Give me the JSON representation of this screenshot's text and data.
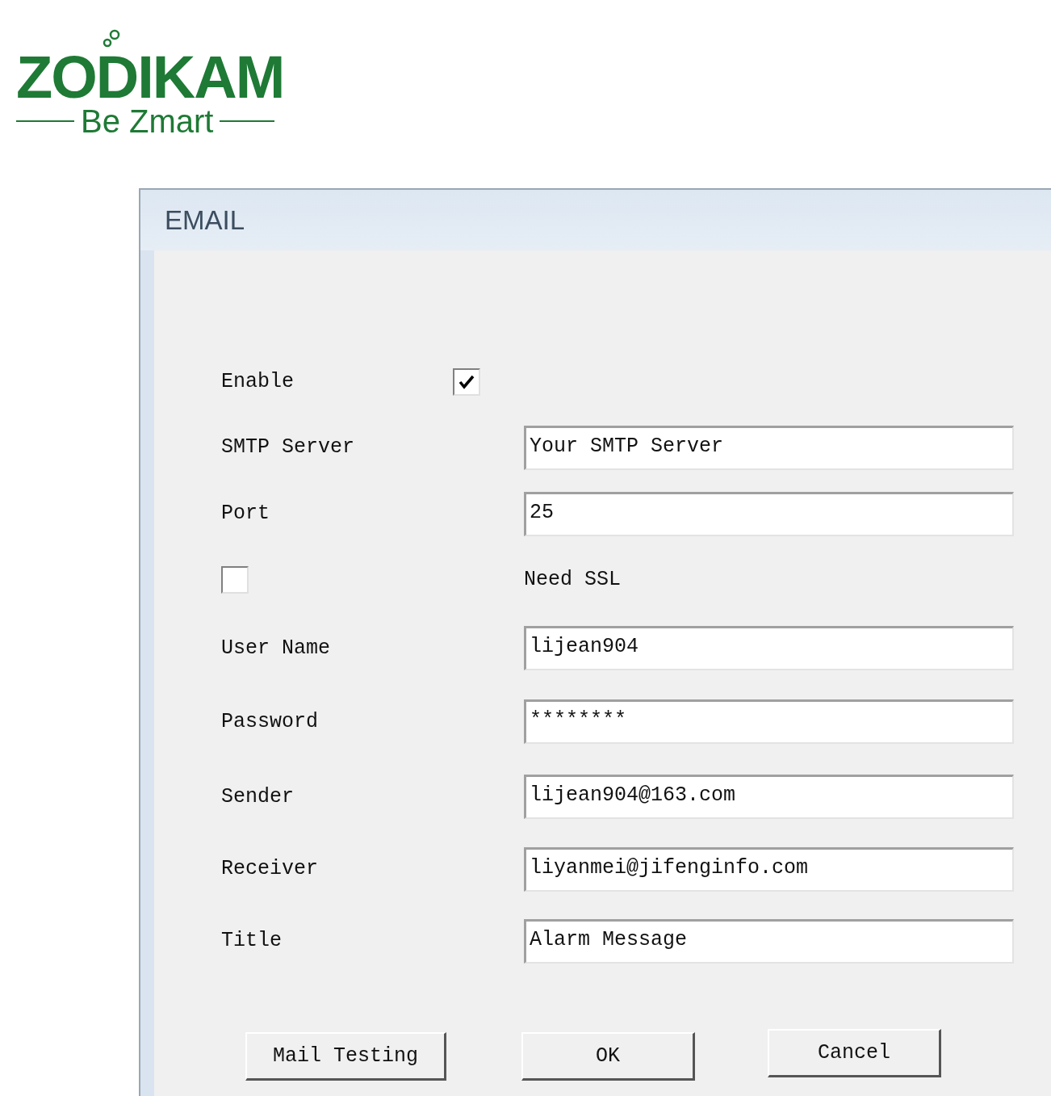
{
  "logo": {
    "name": "ZODIKAM",
    "tagline": "Be Zmart"
  },
  "window": {
    "title": "EMAIL"
  },
  "fields": [
    {
      "kind": "checkbox",
      "label": "Enable",
      "checked": true
    },
    {
      "kind": "text",
      "label": "SMTP Server",
      "value": "Your SMTP Server"
    },
    {
      "kind": "text",
      "label": "Port",
      "value": "25"
    },
    {
      "kind": "checkbox_first",
      "label": "Need SSL",
      "checked": false
    },
    {
      "kind": "text",
      "label": "User Name",
      "value": "lijean904"
    },
    {
      "kind": "text",
      "label": "Password",
      "value": "********"
    },
    {
      "kind": "text",
      "label": "Sender",
      "value": "lijean904@163.com"
    },
    {
      "kind": "text",
      "label": "Receiver",
      "value": "liyanmei@jifenginfo.com"
    },
    {
      "kind": "text",
      "label": "Title",
      "value": "Alarm Message"
    }
  ],
  "buttons": [
    "Mail Testing",
    "OK",
    "Cancel"
  ]
}
